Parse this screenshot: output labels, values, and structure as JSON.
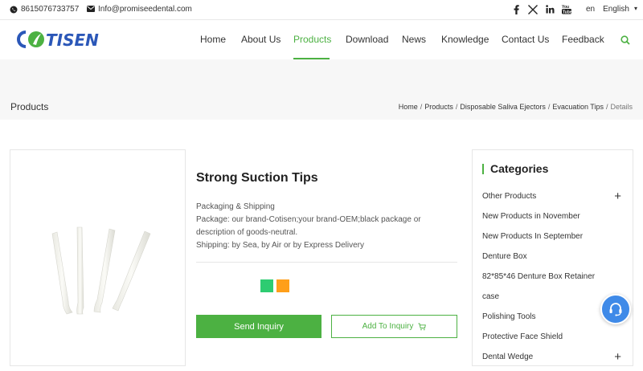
{
  "topbar": {
    "phone": "8615076733757",
    "email": "Info@promiseedental.com",
    "social_icons": [
      "facebook-icon",
      "x-icon",
      "linkedin-icon",
      "youtube-icon"
    ],
    "lang_code": "en",
    "language": "English"
  },
  "brand": {
    "logo_text": "CŌTISEN",
    "accent": "#4cb142",
    "logo_color": "#2b57b8"
  },
  "nav": {
    "items": [
      {
        "label": "Home"
      },
      {
        "label": "About Us"
      },
      {
        "label": "Products"
      },
      {
        "label": "Download"
      },
      {
        "label": "News"
      },
      {
        "label": "Knowledge"
      },
      {
        "label": "Contact Us"
      },
      {
        "label": "Feedback"
      }
    ],
    "active": "Products"
  },
  "banner": {
    "title": "Products",
    "breadcrumb": [
      "Home",
      "Products",
      "Disposable Saliva Ejectors",
      "Evacuation Tips",
      "Details"
    ]
  },
  "product": {
    "name": "Strong Suction Tips",
    "desc_lines": [
      "Packaging & Shipping",
      "Package: our brand-Cotisen;your brand-OEM;black package or description of goods-neutral.",
      "Shipping: by Sea, by Air or by Express Delivery"
    ],
    "colors": [
      "#2ecc71",
      "#ff9f1a"
    ],
    "send_inquiry": "Send Inquiry",
    "add_to_inquiry": "Add To Inquiry"
  },
  "sidebar": {
    "title": "Categories",
    "items": [
      {
        "label": "Other Products",
        "expandable": true
      },
      {
        "label": "New Products in November",
        "expandable": false
      },
      {
        "label": "New Products In September",
        "expandable": false
      },
      {
        "label": "Denture Box",
        "expandable": false
      },
      {
        "label": "82*85*46 Denture Box Retainer",
        "expandable": false
      },
      {
        "label": "case",
        "expandable": false
      },
      {
        "label": "Polishing Tools",
        "expandable": false
      },
      {
        "label": "Protective Face Shield",
        "expandable": false
      },
      {
        "label": "Dental Wedge",
        "expandable": true
      }
    ]
  }
}
